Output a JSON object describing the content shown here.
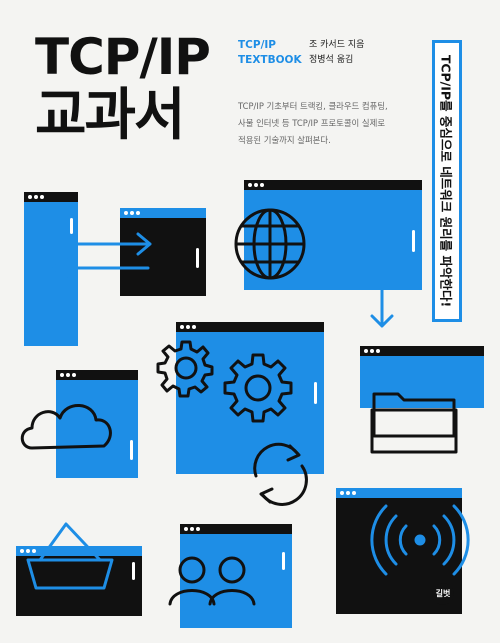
{
  "cover": {
    "title_line1": "TCP/IP",
    "title_line2": "교과서",
    "english_title_line1": "TCP/IP",
    "english_title_line2": "TEXTBOOK",
    "author": "조 카서드 지음",
    "translator": "정병석 옮김",
    "description_lines": [
      "TCP/IP 기초부터 트랙킹, 클라우드 컴퓨팅,",
      "사물 인터넷 등 TCP/IP 프로토콜이 실제로",
      "적용된 기술까지 살펴본다."
    ],
    "banner": "TCP/IP를 중심으로 네트워크 원리를 파악한다!",
    "publisher_logo": "길벗"
  },
  "colors": {
    "accent": "#1e8ee6",
    "ink": "#111111",
    "background": "#f4f4f2"
  },
  "icons": [
    "arrows-exchange-icon",
    "globe-icon",
    "gear-icon",
    "cloud-icon",
    "folder-icon",
    "refresh-icon",
    "wifi-icon",
    "basket-icon",
    "users-icon"
  ]
}
